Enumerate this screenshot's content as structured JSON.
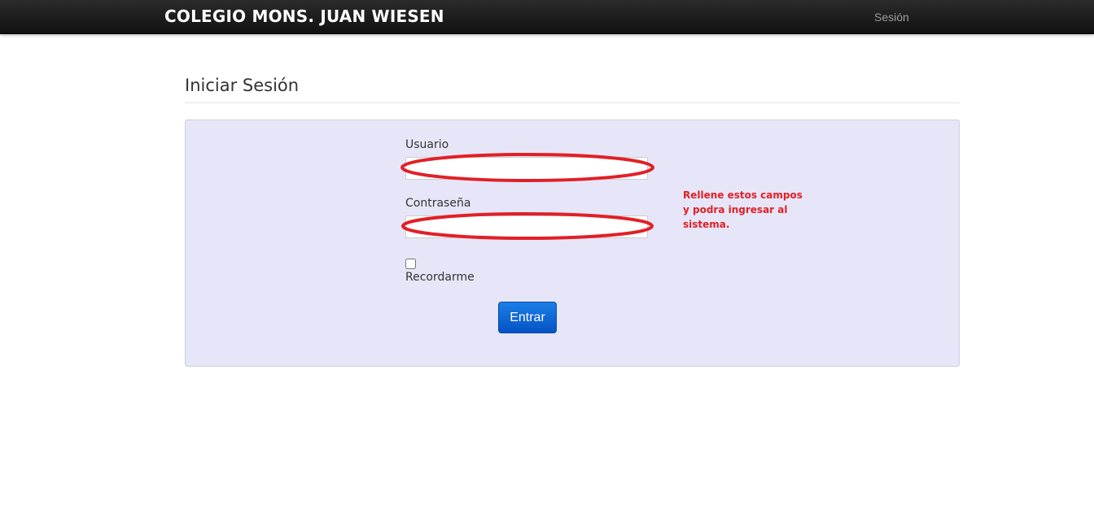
{
  "header": {
    "brand": "COLEGIO MONS. JUAN WIESEN",
    "nav_session": "Sesión"
  },
  "page": {
    "title": "Iniciar Sesión"
  },
  "form": {
    "username_label": "Usuario",
    "username_value": "",
    "password_label": "Contraseña",
    "password_value": "",
    "remember_label": "Recordarme",
    "remember_checked": false,
    "submit_label": "Entrar"
  },
  "annotation": {
    "note_lines": [
      "Rellene estos campos",
      "y podra ingresar al",
      "sistema."
    ],
    "color": "#e21f26"
  },
  "colors": {
    "navbar": "#1b1b1b",
    "panel": "#e6e6f8",
    "button": "#0a62d3"
  }
}
